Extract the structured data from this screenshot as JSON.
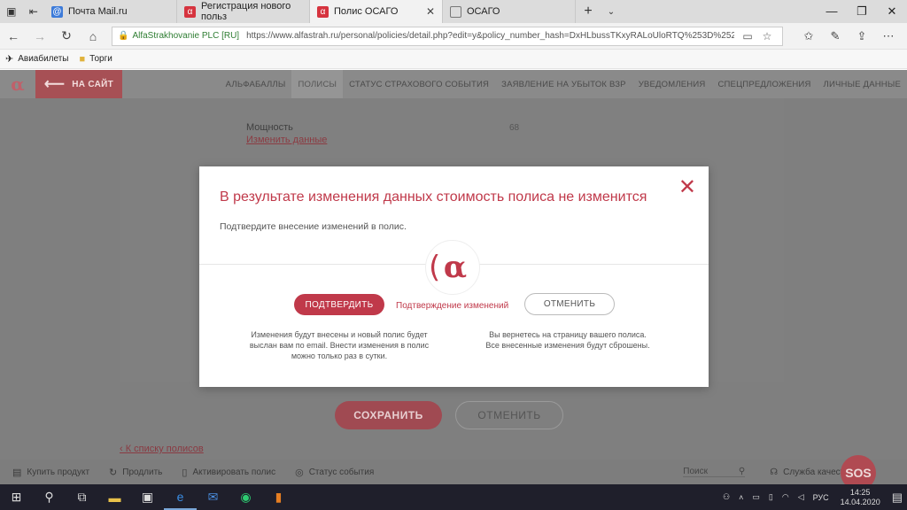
{
  "browser": {
    "tabs": [
      {
        "label": "Почта Mail.ru",
        "icon": "mailru-icon",
        "color": "#3d7bd9"
      },
      {
        "label": "Регистрация нового польз",
        "icon": "alfa-icon",
        "color": "#d6343f"
      },
      {
        "label": "Полис ОСАГО",
        "icon": "alfa-icon",
        "color": "#d6343f",
        "active": true
      },
      {
        "label": "ОСАГО",
        "icon": "page-icon",
        "color": "#777777"
      }
    ],
    "site_identity": "AlfaStrakhovanie PLC [RU]",
    "url": "https://www.alfastrah.ru/personal/policies/detail.php?edit=y&policy_number_hash=DxHLbussTKxyRALoUloRTQ%253D%252"
  },
  "favorites": [
    {
      "label": "Авиабилеты",
      "icon": "plane-icon"
    },
    {
      "label": "Торги",
      "icon": "folder-icon"
    }
  ],
  "site": {
    "logo": "α",
    "back_label": "НА САЙТ",
    "nav": [
      "АЛЬФАБАЛЛЫ",
      "ПОЛИСЫ",
      "СТАТУС СТРАХОВОГО СОБЫТИЯ",
      "ЗАЯВЛЕНИЕ НА УБЫТОК ВЗР",
      "УВЕДОМЛЕНИЯ",
      "СПЕЦПРЕДЛОЖЕНИЯ",
      "ЛИЧНЫЕ ДАННЫЕ"
    ],
    "nav_active": "ПОЛИСЫ"
  },
  "form": {
    "field_label": "Мощность",
    "field_value": "68",
    "change_link": "Изменить данные",
    "save_label": "СОХРАНИТЬ",
    "cancel_label": "ОТМЕНИТЬ",
    "back_link": "‹ К списку полисов"
  },
  "modal": {
    "title": "В результате изменения данных стоимость полиса не изменится",
    "subtitle": "Подтвердите внесение изменений в полис.",
    "confirm_label": "ПОДТВЕРДИТЬ",
    "status_text": "Подтверждение изменений",
    "cancel_label": "ОТМЕНИТЬ",
    "confirm_note_1": "Изменения будут внесены и новый полис будет",
    "confirm_note_2": "выслан вам по email. Внести изменения в полис",
    "confirm_note_3": "можно только раз в сутки.",
    "cancel_note_1": "Вы вернетесь на страницу вашего полиса.",
    "cancel_note_2": "Все внесенные изменения будут сброшены."
  },
  "footer": {
    "items": [
      {
        "label": "Купить продукт",
        "icon": "cart-icon"
      },
      {
        "label": "Продлить",
        "icon": "refresh-icon"
      },
      {
        "label": "Активировать полис",
        "icon": "document-icon"
      },
      {
        "label": "Статус события",
        "icon": "check-circle-icon"
      }
    ],
    "search_label": "Поиск",
    "quality_label": "Служба качества",
    "sos_label": "SOS"
  },
  "taskbar": {
    "lang": "РУС",
    "time": "14:25",
    "date": "14.04.2020"
  },
  "colors": {
    "accent": "#c0394a",
    "overlay": "#7f7f7f"
  }
}
